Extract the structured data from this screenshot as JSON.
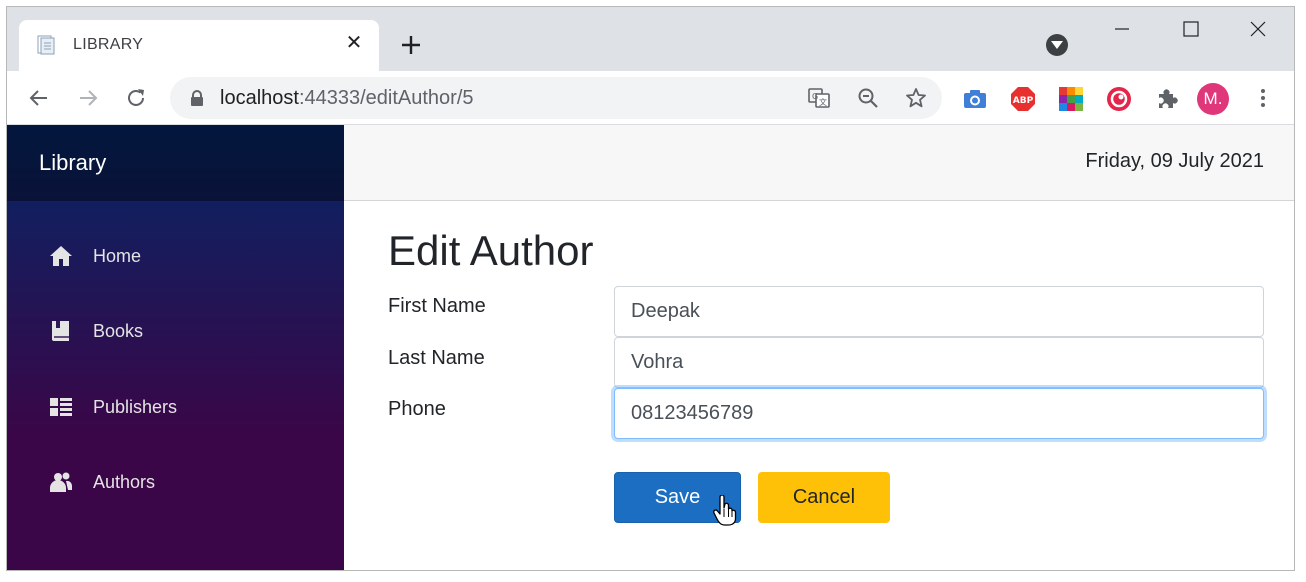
{
  "browser": {
    "tab_title": "LIBRARY",
    "url_host": "localhost",
    "url_rest": ":44333/editAuthor/5",
    "avatar_initial": "M.",
    "icons": [
      "back-icon",
      "forward-icon",
      "reload-icon",
      "lock-icon",
      "translate-icon",
      "zoom-out-icon",
      "star-icon",
      "camera-icon",
      "adblock-icon",
      "colorgrid-icon",
      "record-icon",
      "extensions-icon",
      "menu-icon"
    ]
  },
  "sidebar": {
    "brand": "Library",
    "items": [
      {
        "label": "Home",
        "icon": "home-icon"
      },
      {
        "label": "Books",
        "icon": "book-icon"
      },
      {
        "label": "Publishers",
        "icon": "list-icon"
      },
      {
        "label": "Authors",
        "icon": "people-icon"
      }
    ]
  },
  "header": {
    "date": "Friday, 09 July 2021"
  },
  "form": {
    "title": "Edit Author",
    "fields": [
      {
        "label": "First Name",
        "value": "Deepak"
      },
      {
        "label": "Last Name",
        "value": "Vohra"
      },
      {
        "label": "Phone",
        "value": "08123456789"
      }
    ],
    "save_label": "Save",
    "cancel_label": "Cancel"
  },
  "colors": {
    "save": "#1b6ec2",
    "cancel": "#ffc107",
    "sidebar_top": "#052767",
    "sidebar_bottom": "#3a0647"
  }
}
